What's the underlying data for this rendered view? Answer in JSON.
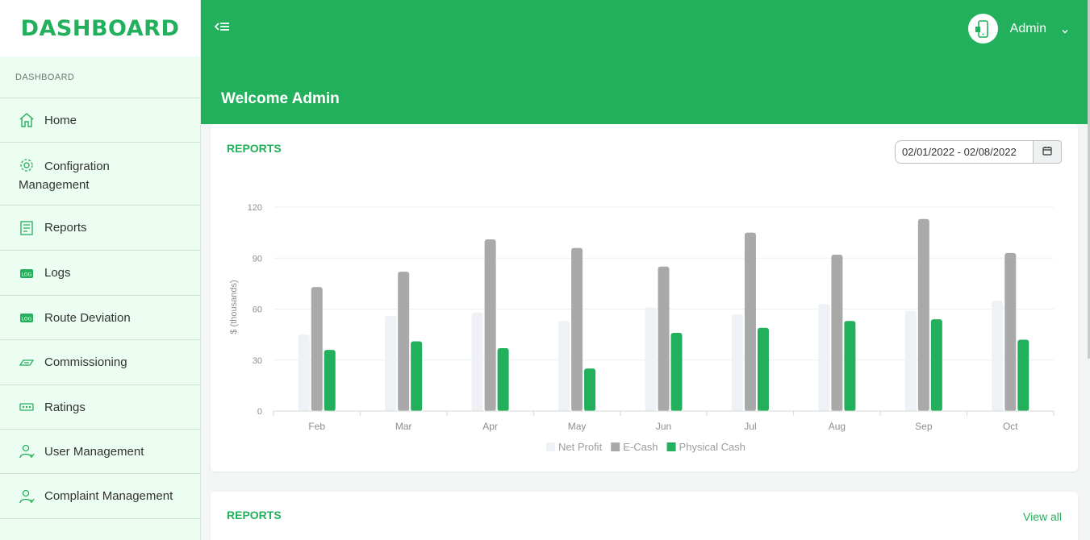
{
  "brand": {
    "title": "DASHBOARD"
  },
  "sidebar": {
    "section": "DASHBOARD",
    "items": [
      {
        "label": "Home",
        "icon": "home-icon"
      },
      {
        "label": "Configration Management",
        "icon": "gear-icon"
      },
      {
        "label": "Reports",
        "icon": "report-icon"
      },
      {
        "label": "Logs",
        "icon": "log-icon"
      },
      {
        "label": "Route Deviation",
        "icon": "log-icon"
      },
      {
        "label": "Commissioning",
        "icon": "money-icon"
      },
      {
        "label": "Ratings",
        "icon": "rating-icon"
      },
      {
        "label": "User Management",
        "icon": "user-icon"
      },
      {
        "label": "Complaint Management",
        "icon": "user-icon"
      }
    ]
  },
  "header": {
    "user_name": "Admin",
    "welcome": "Welcome Admin"
  },
  "reports_card": {
    "title": "REPORTS",
    "date_range": "02/01/2022 - 02/08/2022"
  },
  "reports_card_2": {
    "title": "REPORTS",
    "view_all": "View all"
  },
  "colors": {
    "brand_green": "#22b05c",
    "sidebar_bg": "#ecfdf1",
    "net_profit": "#eef1f5",
    "e_cash": "#a9a9a9",
    "physical_cash": "#22b05c"
  },
  "chart_data": {
    "type": "bar",
    "categories": [
      "Feb",
      "Mar",
      "Apr",
      "May",
      "Jun",
      "Jul",
      "Aug",
      "Sep",
      "Oct"
    ],
    "series": [
      {
        "name": "Net Profit",
        "values": [
          45,
          56,
          58,
          53,
          61,
          57,
          63,
          59,
          65
        ]
      },
      {
        "name": "E-Cash",
        "values": [
          73,
          82,
          101,
          96,
          85,
          105,
          92,
          113,
          93
        ]
      },
      {
        "name": "Physical Cash",
        "values": [
          36,
          41,
          37,
          25,
          46,
          49,
          53,
          54,
          42
        ]
      }
    ],
    "ylabel": "$ (thousands)",
    "ylim": [
      0,
      120
    ],
    "yticks": [
      "0",
      "30",
      "60",
      "90",
      "120"
    ],
    "grid": true,
    "legend": "bottom-center"
  }
}
